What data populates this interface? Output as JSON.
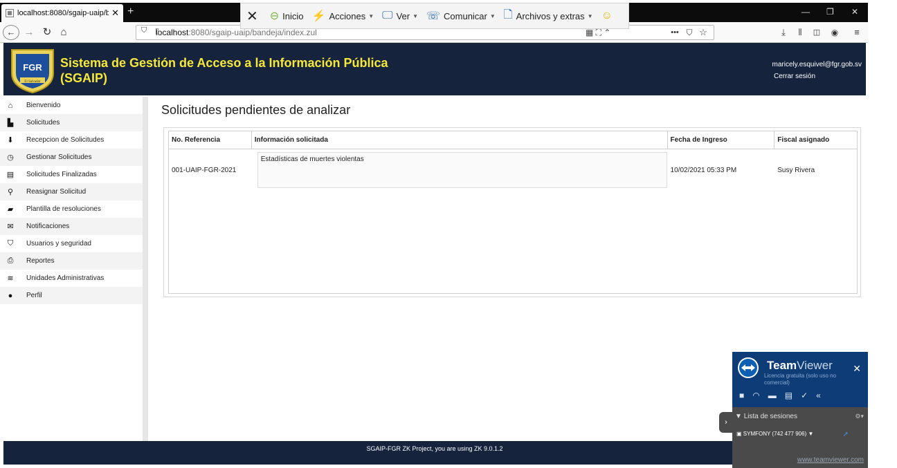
{
  "browser": {
    "tab_title": "localhost:8080/sgaip-uaip/band",
    "url_host": "localhost",
    "url_path": ":8080/sgaip-uaip/bandeja/index.zul",
    "menu_dots": "•••"
  },
  "teamviewer_toolbar": {
    "items": [
      {
        "label": "Inicio"
      },
      {
        "label": "Acciones"
      },
      {
        "label": "Ver"
      },
      {
        "label": "Comunicar"
      },
      {
        "label": "Archivos y extras"
      }
    ]
  },
  "header": {
    "app_title_line1": "Sistema de Gestión de Acceso a la Información Pública",
    "app_title_line2": "(SGAIP)",
    "logo_text": "FGR",
    "logo_subtext": "El Salvador",
    "user_email": "maricely.esquivel@fgr.gob.sv",
    "logout_label": "Cerrar sesión",
    "brand_color": "#15233d",
    "title_color": "#f6e83a"
  },
  "sidebar": {
    "items": [
      {
        "label": "Bienvenido",
        "icon": "home-icon"
      },
      {
        "label": "Solicitudes",
        "icon": "file-icon"
      },
      {
        "label": "Recepcion de Solicitudes",
        "icon": "download-icon"
      },
      {
        "label": "Gestionar Solicitudes",
        "icon": "clock-icon"
      },
      {
        "label": "Solicitudes Finalizadas",
        "icon": "archive-icon"
      },
      {
        "label": "Reasignar Solicitud",
        "icon": "user-plus-icon"
      },
      {
        "label": "Plantilla de resoluciones",
        "icon": "folder-icon"
      },
      {
        "label": "Notificaciones",
        "icon": "envelope-icon"
      },
      {
        "label": "Usuarios y seguridad",
        "icon": "shield-icon"
      },
      {
        "label": "Reportes",
        "icon": "print-icon"
      },
      {
        "label": "Unidades Administrativas",
        "icon": "layers-icon"
      },
      {
        "label": "Perfil",
        "icon": "user-icon"
      }
    ]
  },
  "main": {
    "page_title": "Solicitudes pendientes de analizar",
    "columns": [
      "No. Referencia",
      "Información solicitada",
      "Fecha de Ingreso",
      "Fiscal asignado"
    ],
    "rows": [
      {
        "reference": "001-UAIP-FGR-2021",
        "info": "Estadísticas de muertes violentas",
        "date": "10/02/2021 05:33 PM",
        "fiscal": "Susy Rivera"
      }
    ]
  },
  "footer": {
    "text": "SGAIP-FGR ZK Project, you are using ZK 9.0.1.2"
  },
  "teamviewer_panel": {
    "brand_prefix": "Team",
    "brand_suffix": "Viewer",
    "license": "Licencia gratuita (solo uso no comercial)",
    "list_title": "Lista de sesiones",
    "session": "SYMFONY (742 477 906)",
    "link": "www.teamviewer.com"
  }
}
